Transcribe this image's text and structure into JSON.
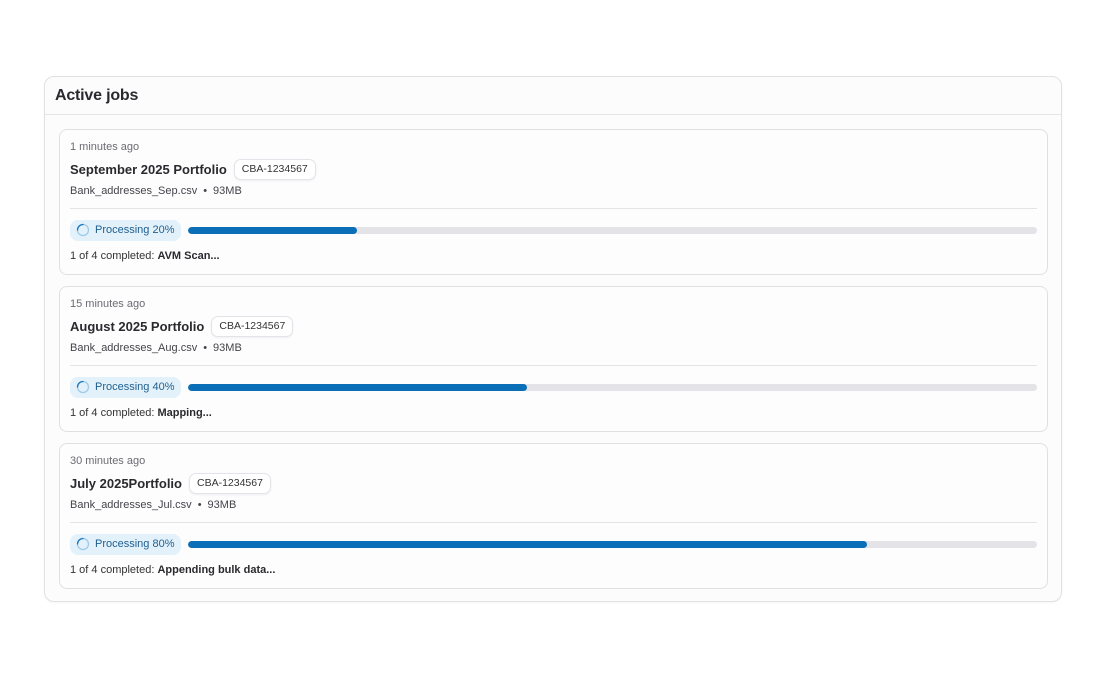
{
  "panel": {
    "title": "Active jobs"
  },
  "jobs": [
    {
      "time": "1 minutes ago",
      "title": "September 2025 Portfolio",
      "id": "CBA-1234567",
      "file": "Bank_addresses_Sep.csv",
      "size": "93MB",
      "status": "Processing 20%",
      "progress": 0.2,
      "step_prefix": "1 of 4 completed:",
      "step_name": "AVM Scan..."
    },
    {
      "time": "15 minutes ago",
      "title": "August 2025 Portfolio",
      "id": "CBA-1234567",
      "file": "Bank_addresses_Aug.csv",
      "size": "93MB",
      "status": "Processing 40%",
      "progress": 0.4,
      "step_prefix": "1 of 4 completed:",
      "step_name": "Mapping..."
    },
    {
      "time": "30 minutes ago",
      "title": "July 2025Portfolio",
      "id": "CBA-1234567",
      "file": "Bank_addresses_Jul.csv",
      "size": "93MB",
      "status": "Processing 80%",
      "progress": 0.8,
      "step_prefix": "1 of 4 completed:",
      "step_name": "Appending bulk data..."
    }
  ],
  "colors": {
    "accent": "#0a6fb7",
    "pill_bg": "#e3f1fb",
    "track": "#e3e3e8"
  },
  "icons": {
    "status": "spinner-icon"
  }
}
